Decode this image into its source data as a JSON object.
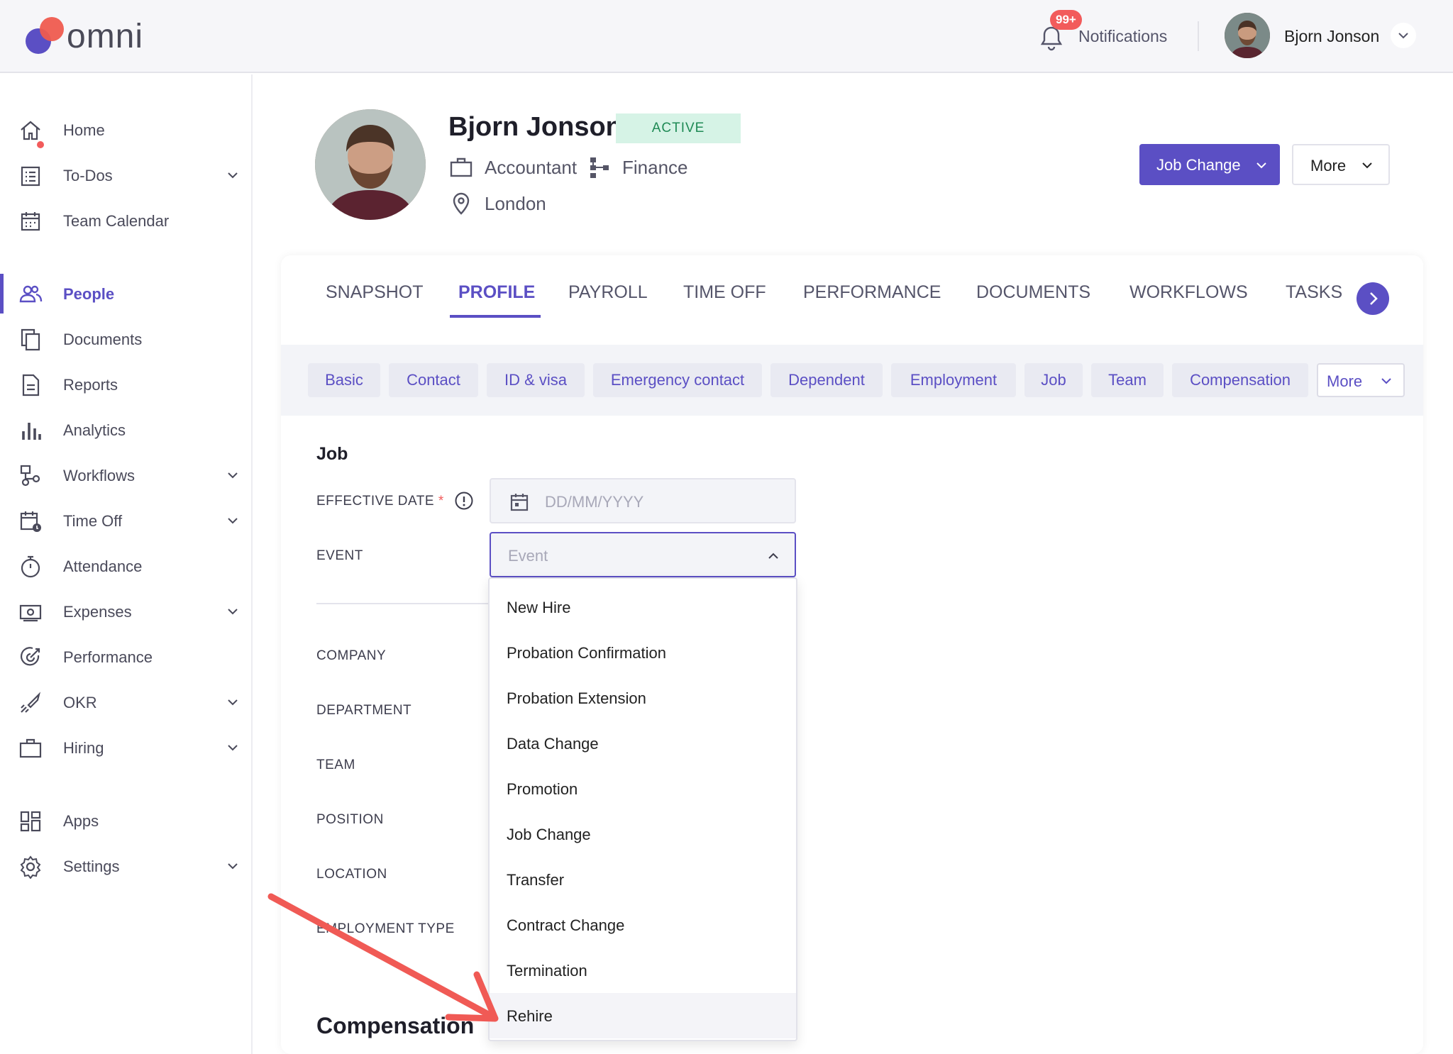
{
  "brand": {
    "name": "omni"
  },
  "topbar": {
    "notifications_badge": "99+",
    "notifications_label": "Notifications",
    "user_name": "Bjorn Jonson"
  },
  "sidebar": {
    "items": [
      {
        "label": "Home",
        "icon": "home-icon",
        "has_chevron": false
      },
      {
        "label": "To-Dos",
        "icon": "todo-list-icon",
        "has_chevron": true
      },
      {
        "label": "Team Calendar",
        "icon": "calendar-icon",
        "has_chevron": false
      },
      {
        "label": "People",
        "icon": "people-icon",
        "has_chevron": false,
        "active": true
      },
      {
        "label": "Documents",
        "icon": "documents-icon",
        "has_chevron": false
      },
      {
        "label": "Reports",
        "icon": "report-icon",
        "has_chevron": false
      },
      {
        "label": "Analytics",
        "icon": "bar-chart-icon",
        "has_chevron": false
      },
      {
        "label": "Workflows",
        "icon": "workflow-icon",
        "has_chevron": true
      },
      {
        "label": "Time Off",
        "icon": "time-off-icon",
        "has_chevron": true
      },
      {
        "label": "Attendance",
        "icon": "stopwatch-icon",
        "has_chevron": false
      },
      {
        "label": "Expenses",
        "icon": "cash-icon",
        "has_chevron": true
      },
      {
        "label": "Performance",
        "icon": "performance-icon",
        "has_chevron": false
      },
      {
        "label": "OKR",
        "icon": "rocket-icon",
        "has_chevron": true
      },
      {
        "label": "Hiring",
        "icon": "briefcase-icon",
        "has_chevron": true
      },
      {
        "label": "Apps",
        "icon": "apps-grid-icon",
        "has_chevron": false
      },
      {
        "label": "Settings",
        "icon": "gear-icon",
        "has_chevron": true
      }
    ]
  },
  "profile": {
    "name": "Bjorn Jonson",
    "status": "ACTIVE",
    "title": "Accountant",
    "department": "Finance",
    "location": "London",
    "primary_action": "Job Change",
    "secondary_action": "More"
  },
  "tabs": [
    "SNAPSHOT",
    "PROFILE",
    "PAYROLL",
    "TIME OFF",
    "PERFORMANCE",
    "DOCUMENTS",
    "WORKFLOWS",
    "TASKS"
  ],
  "active_tab": "PROFILE",
  "subtabs": [
    "Basic",
    "Contact",
    "ID & visa",
    "Emergency contact",
    "Dependent",
    "Employment",
    "Job",
    "Team",
    "Compensation"
  ],
  "subtabs_more": "More",
  "form": {
    "section_title": "Job",
    "effective_date_label": "EFFECTIVE DATE",
    "required_mark": "*",
    "effective_date_placeholder": "DD/MM/YYYY",
    "event_label": "EVENT",
    "event_placeholder": "Event",
    "fields": [
      "COMPANY",
      "DEPARTMENT",
      "TEAM",
      "POSITION",
      "LOCATION",
      "EMPLOYMENT TYPE"
    ],
    "next_section_title": "Compensation"
  },
  "event_options": [
    "New Hire",
    "Probation Confirmation",
    "Probation Extension",
    "Data Change",
    "Promotion",
    "Job Change",
    "Transfer",
    "Contract Change",
    "Termination",
    "Rehire"
  ],
  "highlighted_option": "Rehire",
  "colors": {
    "accent": "#5b4fc4",
    "danger": "#f25b5b",
    "status_bg": "#d6f3e6",
    "status_text": "#1f8a55",
    "annotation_arrow": "#f05a55"
  }
}
